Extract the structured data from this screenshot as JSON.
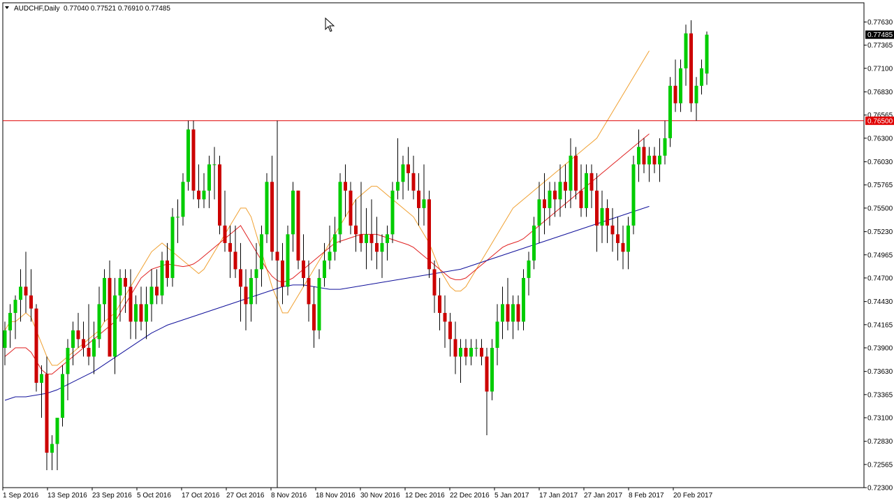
{
  "header": {
    "symbol": "AUDCHF,Daily",
    "ohlc": "0.77040 0.77521 0.76910 0.77485"
  },
  "price_axis": {
    "labels": [
      "0.77630",
      "0.77365",
      "0.77100",
      "0.76830",
      "0.76565",
      "0.76300",
      "0.76030",
      "0.75765",
      "0.75500",
      "0.75230",
      "0.74965",
      "0.74700",
      "0.74430",
      "0.74165",
      "0.73900",
      "0.73630",
      "0.73365",
      "0.73100",
      "0.72830",
      "0.72565",
      "0.72300"
    ],
    "current_price_label": "0.77485",
    "hline_label": "0.76500"
  },
  "time_axis": {
    "labels": [
      "1 Sep 2016",
      "13 Sep 2016",
      "23 Sep 2016",
      "5 Oct 2016",
      "17 Oct 2016",
      "27 Oct 2016",
      "8 Nov 2016",
      "18 Nov 2016",
      "30 Nov 2016",
      "12 Dec 2016",
      "22 Dec 2016",
      "5 Jan 2017",
      "17 Jan 2017",
      "27 Jan 2017",
      "8 Feb 2017",
      "20 Feb 2017"
    ]
  },
  "colors": {
    "bull": "#00cc00",
    "bear": "#cc0000",
    "wick": "#000000",
    "ma_fast": "#f0a030",
    "ma_mid": "#e02020",
    "ma_slow": "#10109a",
    "hline": "#e00000",
    "label_bg_current": "#000000",
    "label_bg_hline": "#e00000"
  },
  "chart_data": {
    "type": "candlestick",
    "symbol": "AUDCHF",
    "timeframe": "Daily",
    "ylim": [
      0.723,
      0.7785
    ],
    "horizontal_line": 0.765,
    "candles": [
      [
        0.739,
        0.742,
        0.737,
        0.741
      ],
      [
        0.741,
        0.744,
        0.739,
        0.743
      ],
      [
        0.743,
        0.745,
        0.74,
        0.7445
      ],
      [
        0.7445,
        0.748,
        0.742,
        0.746
      ],
      [
        0.746,
        0.75,
        0.743,
        0.745
      ],
      [
        0.745,
        0.748,
        0.742,
        0.7435
      ],
      [
        0.7435,
        0.744,
        0.734,
        0.735
      ],
      [
        0.735,
        0.737,
        0.731,
        0.736
      ],
      [
        0.736,
        0.738,
        0.725,
        0.727
      ],
      [
        0.727,
        0.729,
        0.725,
        0.728
      ],
      [
        0.728,
        0.73,
        0.725,
        0.731
      ],
      [
        0.731,
        0.737,
        0.73,
        0.736
      ],
      [
        0.736,
        0.74,
        0.733,
        0.739
      ],
      [
        0.739,
        0.742,
        0.737,
        0.741
      ],
      [
        0.741,
        0.743,
        0.739,
        0.74
      ],
      [
        0.74,
        0.742,
        0.738,
        0.739
      ],
      [
        0.739,
        0.744,
        0.737,
        0.738
      ],
      [
        0.738,
        0.742,
        0.736,
        0.74
      ],
      [
        0.74,
        0.746,
        0.739,
        0.744
      ],
      [
        0.744,
        0.748,
        0.742,
        0.747
      ],
      [
        0.747,
        0.749,
        0.74,
        0.738
      ],
      [
        0.738,
        0.747,
        0.736,
        0.745
      ],
      [
        0.745,
        0.748,
        0.742,
        0.747
      ],
      [
        0.747,
        0.748,
        0.743,
        0.746
      ],
      [
        0.746,
        0.748,
        0.74,
        0.742
      ],
      [
        0.742,
        0.745,
        0.74,
        0.744
      ],
      [
        0.744,
        0.746,
        0.741,
        0.742
      ],
      [
        0.742,
        0.746,
        0.74,
        0.744
      ],
      [
        0.744,
        0.748,
        0.742,
        0.746
      ],
      [
        0.746,
        0.748,
        0.744,
        0.745
      ],
      [
        0.745,
        0.75,
        0.744,
        0.749
      ],
      [
        0.749,
        0.751,
        0.746,
        0.747
      ],
      [
        0.747,
        0.755,
        0.746,
        0.754
      ],
      [
        0.754,
        0.756,
        0.751,
        0.754
      ],
      [
        0.754,
        0.759,
        0.753,
        0.758
      ],
      [
        0.758,
        0.765,
        0.757,
        0.764
      ],
      [
        0.764,
        0.765,
        0.756,
        0.757
      ],
      [
        0.757,
        0.76,
        0.755,
        0.756
      ],
      [
        0.756,
        0.759,
        0.755,
        0.757
      ],
      [
        0.757,
        0.761,
        0.755,
        0.76
      ],
      [
        0.76,
        0.762,
        0.756,
        0.76
      ],
      [
        0.76,
        0.761,
        0.752,
        0.753
      ],
      [
        0.753,
        0.757,
        0.75,
        0.751
      ],
      [
        0.751,
        0.753,
        0.747,
        0.75
      ],
      [
        0.75,
        0.753,
        0.747,
        0.748
      ],
      [
        0.748,
        0.751,
        0.742,
        0.746
      ],
      [
        0.746,
        0.748,
        0.741,
        0.744
      ],
      [
        0.744,
        0.748,
        0.742,
        0.747
      ],
      [
        0.747,
        0.751,
        0.744,
        0.748
      ],
      [
        0.748,
        0.753,
        0.746,
        0.752
      ],
      [
        0.752,
        0.759,
        0.751,
        0.758
      ],
      [
        0.758,
        0.761,
        0.749,
        0.75
      ],
      [
        0.75,
        0.765,
        0.723,
        0.749
      ],
      [
        0.749,
        0.751,
        0.744,
        0.746
      ],
      [
        0.746,
        0.753,
        0.745,
        0.752
      ],
      [
        0.752,
        0.758,
        0.75,
        0.757
      ],
      [
        0.757,
        0.757,
        0.748,
        0.749
      ],
      [
        0.749,
        0.752,
        0.746,
        0.747
      ],
      [
        0.747,
        0.749,
        0.742,
        0.744
      ],
      [
        0.744,
        0.746,
        0.739,
        0.741
      ],
      [
        0.741,
        0.748,
        0.74,
        0.747
      ],
      [
        0.747,
        0.751,
        0.746,
        0.749
      ],
      [
        0.749,
        0.753,
        0.748,
        0.75
      ],
      [
        0.75,
        0.754,
        0.749,
        0.752
      ],
      [
        0.752,
        0.759,
        0.751,
        0.758
      ],
      [
        0.758,
        0.76,
        0.754,
        0.757
      ],
      [
        0.757,
        0.758,
        0.752,
        0.753
      ],
      [
        0.753,
        0.756,
        0.75,
        0.752
      ],
      [
        0.752,
        0.758,
        0.75,
        0.751
      ],
      [
        0.751,
        0.755,
        0.748,
        0.752
      ],
      [
        0.752,
        0.756,
        0.749,
        0.751
      ],
      [
        0.751,
        0.754,
        0.748,
        0.75
      ],
      [
        0.75,
        0.752,
        0.747,
        0.751
      ],
      [
        0.751,
        0.753,
        0.749,
        0.752
      ],
      [
        0.752,
        0.758,
        0.751,
        0.757
      ],
      [
        0.757,
        0.763,
        0.756,
        0.758
      ],
      [
        0.758,
        0.761,
        0.756,
        0.76
      ],
      [
        0.76,
        0.762,
        0.757,
        0.759
      ],
      [
        0.759,
        0.761,
        0.756,
        0.757
      ],
      [
        0.757,
        0.759,
        0.753,
        0.755
      ],
      [
        0.755,
        0.76,
        0.753,
        0.756
      ],
      [
        0.756,
        0.757,
        0.747,
        0.748
      ],
      [
        0.748,
        0.749,
        0.743,
        0.745
      ],
      [
        0.745,
        0.747,
        0.741,
        0.743
      ],
      [
        0.743,
        0.745,
        0.739,
        0.742
      ],
      [
        0.742,
        0.743,
        0.738,
        0.74
      ],
      [
        0.74,
        0.742,
        0.736,
        0.738
      ],
      [
        0.738,
        0.74,
        0.735,
        0.739
      ],
      [
        0.739,
        0.74,
        0.737,
        0.738
      ],
      [
        0.738,
        0.74,
        0.737,
        0.739
      ],
      [
        0.739,
        0.74,
        0.738,
        0.739
      ],
      [
        0.739,
        0.74,
        0.737,
        0.738
      ],
      [
        0.738,
        0.739,
        0.729,
        0.734
      ],
      [
        0.734,
        0.74,
        0.733,
        0.739
      ],
      [
        0.739,
        0.744,
        0.737,
        0.742
      ],
      [
        0.742,
        0.746,
        0.74,
        0.744
      ],
      [
        0.744,
        0.747,
        0.741,
        0.742
      ],
      [
        0.742,
        0.745,
        0.74,
        0.744
      ],
      [
        0.744,
        0.745,
        0.741,
        0.742
      ],
      [
        0.742,
        0.748,
        0.741,
        0.747
      ],
      [
        0.747,
        0.75,
        0.745,
        0.749
      ],
      [
        0.749,
        0.754,
        0.748,
        0.753
      ],
      [
        0.753,
        0.758,
        0.751,
        0.756
      ],
      [
        0.756,
        0.759,
        0.752,
        0.755
      ],
      [
        0.755,
        0.758,
        0.753,
        0.757
      ],
      [
        0.757,
        0.758,
        0.754,
        0.756
      ],
      [
        0.756,
        0.76,
        0.754,
        0.758
      ],
      [
        0.758,
        0.76,
        0.755,
        0.757
      ],
      [
        0.757,
        0.763,
        0.755,
        0.761
      ],
      [
        0.761,
        0.762,
        0.756,
        0.757
      ],
      [
        0.757,
        0.76,
        0.754,
        0.755
      ],
      [
        0.755,
        0.76,
        0.754,
        0.759
      ],
      [
        0.759,
        0.76,
        0.755,
        0.757
      ],
      [
        0.757,
        0.759,
        0.75,
        0.753
      ],
      [
        0.753,
        0.757,
        0.751,
        0.755
      ],
      [
        0.755,
        0.756,
        0.751,
        0.753
      ],
      [
        0.753,
        0.755,
        0.75,
        0.752
      ],
      [
        0.752,
        0.754,
        0.749,
        0.751
      ],
      [
        0.751,
        0.753,
        0.748,
        0.75
      ],
      [
        0.75,
        0.754,
        0.748,
        0.753
      ],
      [
        0.753,
        0.761,
        0.752,
        0.76
      ],
      [
        0.76,
        0.764,
        0.758,
        0.762
      ],
      [
        0.762,
        0.763,
        0.759,
        0.76
      ],
      [
        0.76,
        0.762,
        0.758,
        0.761
      ],
      [
        0.761,
        0.762,
        0.759,
        0.76
      ],
      [
        0.76,
        0.763,
        0.758,
        0.761
      ],
      [
        0.761,
        0.765,
        0.76,
        0.763
      ],
      [
        0.763,
        0.77,
        0.762,
        0.769
      ],
      [
        0.769,
        0.772,
        0.766,
        0.767
      ],
      [
        0.767,
        0.772,
        0.766,
        0.771
      ],
      [
        0.771,
        0.776,
        0.769,
        0.775
      ],
      [
        0.775,
        0.7765,
        0.766,
        0.767
      ],
      [
        0.767,
        0.77,
        0.765,
        0.769
      ],
      [
        0.769,
        0.772,
        0.768,
        0.771
      ],
      [
        0.7704,
        0.77521,
        0.7691,
        0.77485
      ]
    ],
    "moving_averages": [
      {
        "color_key": "ma_fast",
        "values": [
          0.741,
          0.742,
          0.742,
          0.7425,
          0.743,
          0.7425,
          0.741,
          0.7395,
          0.738,
          0.737,
          0.737,
          0.7375,
          0.738,
          0.7385,
          0.739,
          0.7395,
          0.74,
          0.7405,
          0.741,
          0.742,
          0.7425,
          0.743,
          0.744,
          0.745,
          0.746,
          0.747,
          0.748,
          0.749,
          0.75,
          0.7505,
          0.751,
          0.7505,
          0.75,
          0.7495,
          0.749,
          0.7485,
          0.748,
          0.7475,
          0.748,
          0.749,
          0.75,
          0.751,
          0.752,
          0.753,
          0.754,
          0.755,
          0.755,
          0.754,
          0.752,
          0.75,
          0.748,
          0.746,
          0.7445,
          0.743,
          0.743,
          0.744,
          0.745,
          0.746,
          0.747,
          0.748,
          0.749,
          0.75,
          0.751,
          0.752,
          0.753,
          0.754,
          0.755,
          0.756,
          0.7565,
          0.757,
          0.7575,
          0.7575,
          0.757,
          0.7565,
          0.756,
          0.7555,
          0.755,
          0.7545,
          0.754,
          0.753,
          0.752,
          0.751,
          0.7495,
          0.748,
          0.747,
          0.746,
          0.7455,
          0.7455,
          0.746,
          0.747,
          0.748,
          0.749,
          0.75,
          0.751,
          0.752,
          0.753,
          0.754,
          0.755,
          0.7555,
          0.756,
          0.7565,
          0.757,
          0.7575,
          0.758,
          0.7585,
          0.759,
          0.7595,
          0.76,
          0.7605,
          0.761,
          0.7615,
          0.762,
          0.7625,
          0.763,
          0.764,
          0.765,
          0.766,
          0.767,
          0.768,
          0.769,
          0.77,
          0.771,
          0.772,
          0.773
        ]
      },
      {
        "color_key": "ma_mid",
        "values": [
          0.738,
          0.7385,
          0.739,
          0.739,
          0.739,
          0.7385,
          0.7375,
          0.7365,
          0.736,
          0.736,
          0.7365,
          0.737,
          0.7375,
          0.738,
          0.7385,
          0.739,
          0.7395,
          0.74,
          0.7405,
          0.741,
          0.7415,
          0.742,
          0.743,
          0.744,
          0.745,
          0.746,
          0.747,
          0.7475,
          0.748,
          0.7482,
          0.7484,
          0.7486,
          0.7485,
          0.7484,
          0.7483,
          0.7484,
          0.7486,
          0.749,
          0.7495,
          0.75,
          0.7505,
          0.751,
          0.7515,
          0.752,
          0.7525,
          0.753,
          0.752,
          0.751,
          0.75,
          0.749,
          0.748,
          0.7472,
          0.7467,
          0.7465,
          0.7467,
          0.747,
          0.7475,
          0.748,
          0.7485,
          0.749,
          0.7495,
          0.75,
          0.7505,
          0.751,
          0.7512,
          0.7514,
          0.7516,
          0.7518,
          0.752,
          0.752,
          0.752,
          0.752,
          0.7518,
          0.7516,
          0.7514,
          0.7512,
          0.751,
          0.7508,
          0.7505,
          0.75,
          0.7495,
          0.749,
          0.7485,
          0.748,
          0.7475,
          0.747,
          0.7468,
          0.7468,
          0.747,
          0.7475,
          0.748,
          0.7485,
          0.749,
          0.7495,
          0.75,
          0.7505,
          0.7508,
          0.751,
          0.7512,
          0.7515,
          0.752,
          0.7525,
          0.753,
          0.7535,
          0.754,
          0.7545,
          0.755,
          0.7555,
          0.756,
          0.7565,
          0.757,
          0.7575,
          0.758,
          0.7585,
          0.759,
          0.7595,
          0.76,
          0.7605,
          0.761,
          0.7615,
          0.762,
          0.7625,
          0.763,
          0.7635
        ]
      },
      {
        "color_key": "ma_slow",
        "values": [
          0.733,
          0.7332,
          0.7334,
          0.7334,
          0.7334,
          0.7335,
          0.7336,
          0.7337,
          0.7338,
          0.734,
          0.7342,
          0.7345,
          0.7348,
          0.7351,
          0.7354,
          0.7357,
          0.736,
          0.7363,
          0.7367,
          0.7371,
          0.7375,
          0.7379,
          0.7383,
          0.7387,
          0.7391,
          0.7395,
          0.7399,
          0.7403,
          0.7407,
          0.741,
          0.7413,
          0.7416,
          0.7418,
          0.742,
          0.7422,
          0.7424,
          0.7426,
          0.7428,
          0.743,
          0.7432,
          0.7434,
          0.7436,
          0.7438,
          0.744,
          0.7442,
          0.7444,
          0.7446,
          0.7448,
          0.745,
          0.7452,
          0.7454,
          0.7456,
          0.7458,
          0.746,
          0.7461,
          0.7462,
          0.7462,
          0.7462,
          0.7461,
          0.746,
          0.7459,
          0.7458,
          0.7457,
          0.7457,
          0.7457,
          0.7458,
          0.7459,
          0.746,
          0.7461,
          0.7462,
          0.7463,
          0.7464,
          0.7465,
          0.7466,
          0.7467,
          0.7468,
          0.7469,
          0.747,
          0.7471,
          0.7472,
          0.7473,
          0.7474,
          0.7475,
          0.7476,
          0.7477,
          0.7478,
          0.7479,
          0.748,
          0.7482,
          0.7484,
          0.7486,
          0.7488,
          0.749,
          0.7492,
          0.7494,
          0.7496,
          0.7498,
          0.75,
          0.7502,
          0.7504,
          0.7506,
          0.7508,
          0.751,
          0.7512,
          0.7514,
          0.7516,
          0.7518,
          0.752,
          0.7522,
          0.7524,
          0.7526,
          0.7528,
          0.753,
          0.7532,
          0.7534,
          0.7536,
          0.7538,
          0.754,
          0.7542,
          0.7544,
          0.7546,
          0.7548,
          0.755,
          0.7552
        ]
      }
    ]
  }
}
